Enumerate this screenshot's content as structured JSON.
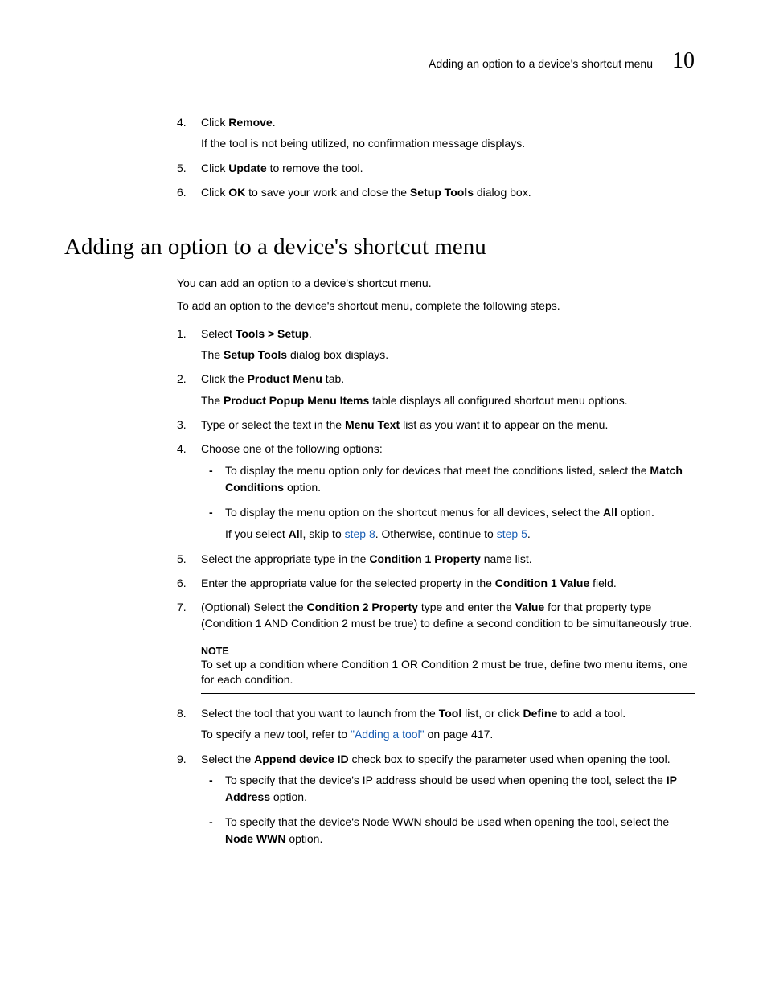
{
  "header": {
    "title": "Adding an option to a device's shortcut menu",
    "chapter": "10"
  },
  "top_steps": {
    "s4_num": "4.",
    "s4_a": "Click ",
    "s4_b": "Remove",
    "s4_c": ".",
    "s4_sub": "If the tool is not being utilized, no confirmation message displays.",
    "s5_num": "5.",
    "s5_a": "Click ",
    "s5_b": "Update",
    "s5_c": " to remove the tool.",
    "s6_num": "6.",
    "s6_a": "Click ",
    "s6_b": "OK",
    "s6_c": " to save your work and close the ",
    "s6_d": "Setup Tools",
    "s6_e": " dialog box."
  },
  "section_title": "Adding an option to a device's shortcut menu",
  "intro1": "You can add an option to a device's shortcut menu.",
  "intro2": "To add an option to the device's shortcut menu, complete the following steps.",
  "steps": {
    "s1_num": "1.",
    "s1_a": "Select ",
    "s1_b": "Tools > Setup",
    "s1_c": ".",
    "s1_sub_a": "The ",
    "s1_sub_b": "Setup Tools",
    "s1_sub_c": " dialog box displays.",
    "s2_num": "2.",
    "s2_a": "Click the ",
    "s2_b": "Product Menu",
    "s2_c": " tab.",
    "s2_sub_a": "The ",
    "s2_sub_b": "Product Popup Menu Items",
    "s2_sub_c": " table displays all configured shortcut menu options.",
    "s3_num": "3.",
    "s3_a": "Type or select the text in the ",
    "s3_b": "Menu Text",
    "s3_c": " list as you want it to appear on the menu.",
    "s4_num": "4.",
    "s4_a": "Choose one of the following options:",
    "s4_d1_a": "To display the menu option only for devices that meet the conditions listed, select the ",
    "s4_d1_b": "Match Conditions",
    "s4_d1_c": " option.",
    "s4_d2_a": "To display the menu option on the shortcut menus for all devices, select the ",
    "s4_d2_b": "All",
    "s4_d2_c": " option.",
    "s4_d2_sub_a": "If you select ",
    "s4_d2_sub_b": "All",
    "s4_d2_sub_c": ", skip to ",
    "s4_d2_sub_link1": "step 8",
    "s4_d2_sub_d": ". Otherwise, continue to ",
    "s4_d2_sub_link2": "step 5",
    "s4_d2_sub_e": ".",
    "s5_num": "5.",
    "s5_a": "Select the appropriate type in the ",
    "s5_b": "Condition 1 Property",
    "s5_c": " name list.",
    "s6_num": "6.",
    "s6_a": "Enter the appropriate value for the selected property in the ",
    "s6_b": "Condition 1 Value",
    "s6_c": " field.",
    "s7_num": "7.",
    "s7_a": "(Optional) Select the ",
    "s7_b": "Condition 2 Property",
    "s7_c": " type and enter the ",
    "s7_d": "Value",
    "s7_e": " for that property type (Condition 1 AND Condition 2 must be true) to define a second condition to be simultaneously true.",
    "note_label": "NOTE",
    "note_text": "To set up a condition where Condition 1 OR Condition 2 must be true, define two menu items, one for each condition.",
    "s8_num": "8.",
    "s8_a": "Select the tool that you want to launch from the ",
    "s8_b": "Tool",
    "s8_c": " list, or click ",
    "s8_d": "Define",
    "s8_e": " to add a tool.",
    "s8_sub_a": "To specify a new tool, refer to ",
    "s8_sub_link": "\"Adding a tool\"",
    "s8_sub_b": " on page 417.",
    "s9_num": "9.",
    "s9_a": "Select the ",
    "s9_b": "Append device ID",
    "s9_c": " check box to specify the parameter used when opening the tool.",
    "s9_d1_a": "To specify that the device's IP address should be used when opening the tool, select the ",
    "s9_d1_b": "IP Address",
    "s9_d1_c": " option.",
    "s9_d2_a": "To specify that the device's Node WWN should be used when opening the tool, select the ",
    "s9_d2_b": "Node WWN",
    "s9_d2_c": " option."
  }
}
